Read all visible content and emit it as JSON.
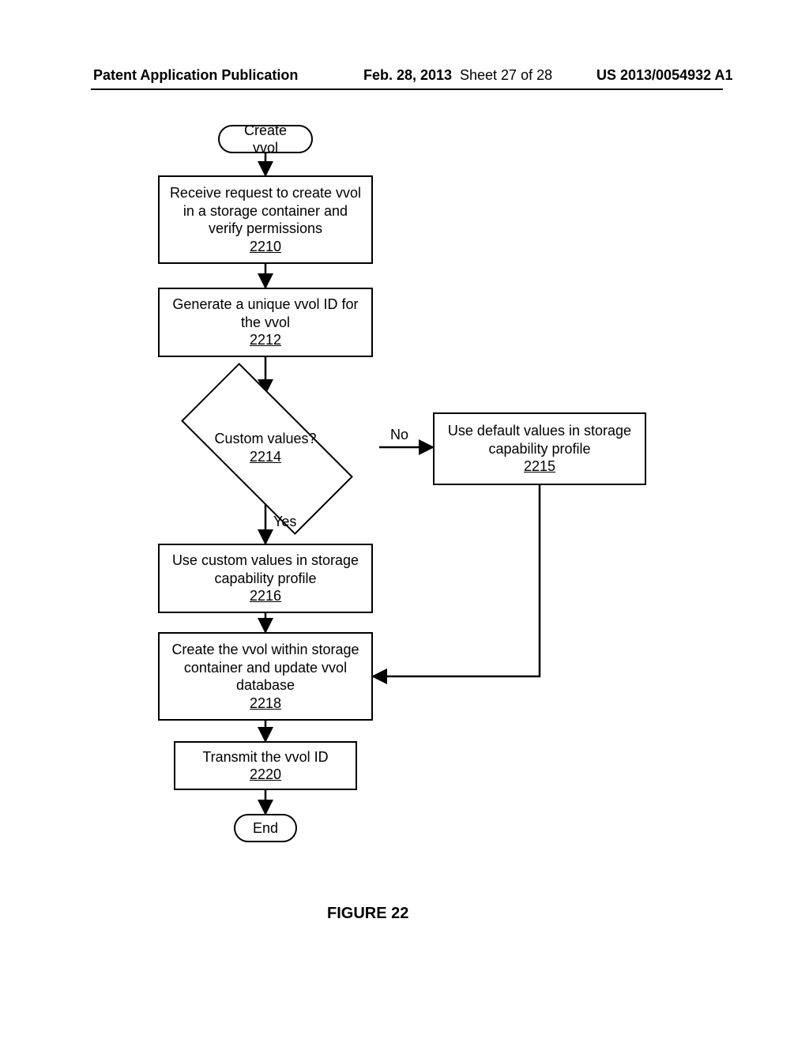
{
  "header": {
    "publication": "Patent Application Publication",
    "date": "Feb. 28, 2013",
    "sheet": "Sheet 27 of 28",
    "docnum": "US 2013/0054932 A1"
  },
  "nodes": {
    "start": {
      "text": "Create vvol"
    },
    "s2210": {
      "text": "Receive request to create vvol in a storage container and verify permissions",
      "ref": "2210"
    },
    "s2212": {
      "text": "Generate a unique vvol ID for the vvol",
      "ref": "2212"
    },
    "d2214": {
      "text": "Custom values?",
      "ref": "2214"
    },
    "s2215": {
      "text": "Use default values in storage capability profile",
      "ref": "2215"
    },
    "s2216": {
      "text": "Use custom values in storage capability profile",
      "ref": "2216"
    },
    "s2218": {
      "text": "Create the vvol within storage container and update vvol database",
      "ref": "2218"
    },
    "s2220": {
      "text": "Transmit the vvol ID",
      "ref": "2220"
    },
    "end": {
      "text": "End"
    }
  },
  "edges": {
    "no": "No",
    "yes": "Yes"
  },
  "figure_label": "FIGURE 22"
}
